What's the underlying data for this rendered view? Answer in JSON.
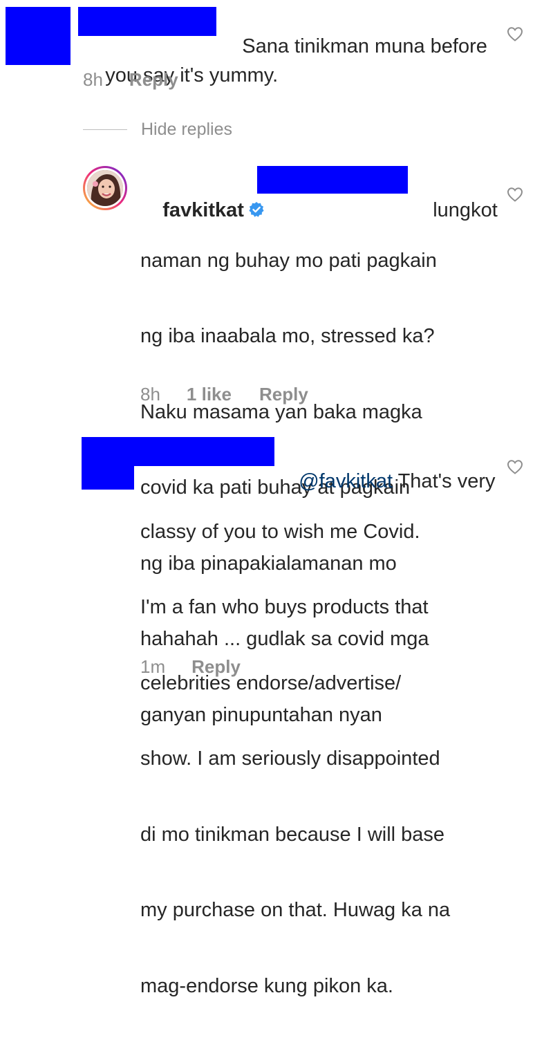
{
  "colors": {
    "redaction": "#0000ff",
    "text": "#262626",
    "muted": "#8e8e8e",
    "mention": "#00376b",
    "verified_badge": "#3897f0"
  },
  "comments": [
    {
      "lines": [
        "Sana tinikman muna before",
        "you say it's yummy."
      ],
      "time": "8h",
      "reply_label": "Reply"
    },
    {
      "username": "favkitkat",
      "verified": true,
      "lines": [
        "lungkot",
        "naman ng buhay mo pati pagkain",
        "ng iba inaabala mo, stressed ka?",
        "Naku masama yan baka magka",
        "covid ka pati buhay at pagkain",
        "ng iba pinapakialamanan mo",
        "hahahah ... gudlak sa covid mga",
        "ganyan pinupuntahan nyan"
      ],
      "time": "8h",
      "likes_label": "1 like",
      "reply_label": "Reply"
    },
    {
      "mention": "@favkitkat",
      "lines": [
        "That's very",
        "classy of you to wish me Covid.",
        "I'm a fan who buys products that",
        "celebrities endorse/advertise/",
        "show. I am seriously disappointed",
        "di mo tinikman because I will base",
        "my purchase on that. Huwag ka na",
        "mag-endorse kung pikon ka."
      ],
      "time": "1m",
      "reply_label": "Reply"
    }
  ],
  "hide_replies_label": "Hide replies",
  "icons": {
    "like": "heart-outline-icon",
    "verified": "verified-badge-icon"
  }
}
